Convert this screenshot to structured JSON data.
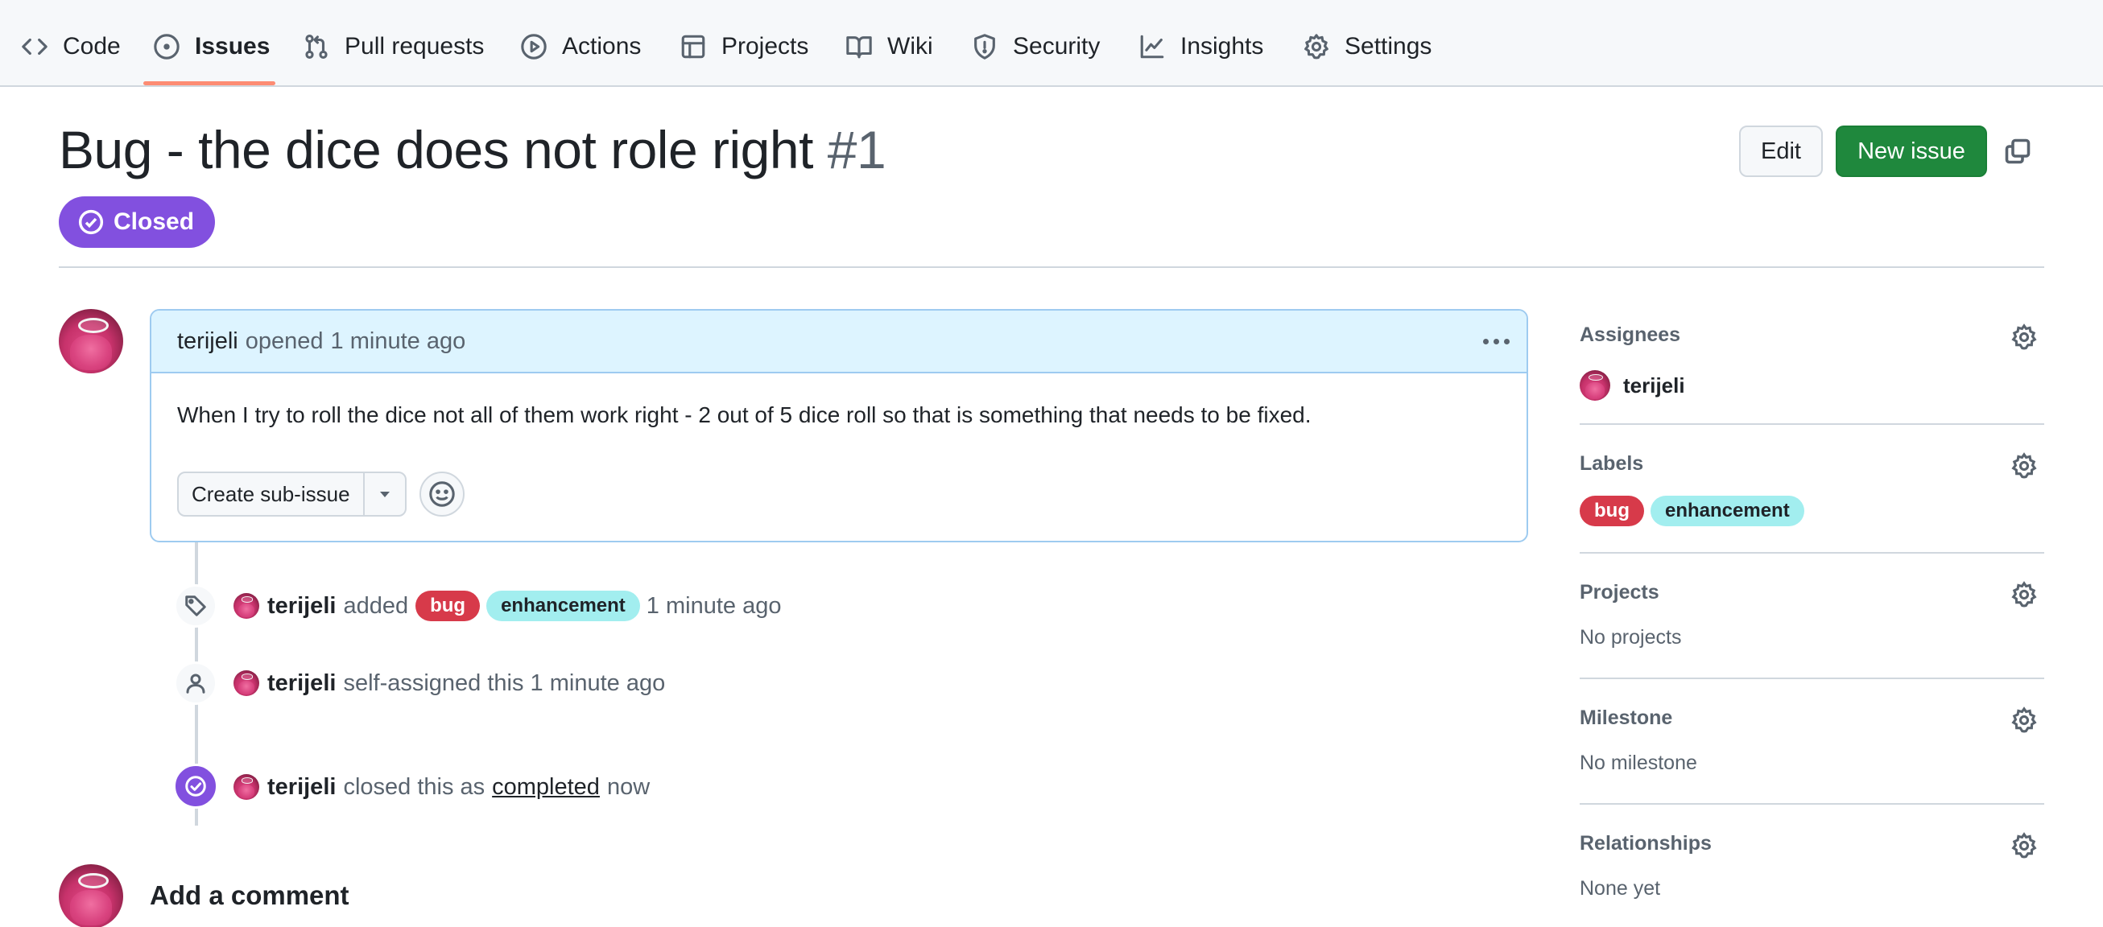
{
  "nav": {
    "items": [
      {
        "label": "Code",
        "icon": "code-icon"
      },
      {
        "label": "Issues",
        "icon": "issue-opened-icon",
        "active": true
      },
      {
        "label": "Pull requests",
        "icon": "git-pull-request-icon"
      },
      {
        "label": "Actions",
        "icon": "play-icon"
      },
      {
        "label": "Projects",
        "icon": "table-icon"
      },
      {
        "label": "Wiki",
        "icon": "book-icon"
      },
      {
        "label": "Security",
        "icon": "shield-icon"
      },
      {
        "label": "Insights",
        "icon": "graph-icon"
      },
      {
        "label": "Settings",
        "icon": "gear-icon"
      }
    ]
  },
  "issue": {
    "title": "Bug - the dice does not role right",
    "number": "#1",
    "state": "Closed",
    "edit_label": "Edit",
    "new_issue_label": "New issue"
  },
  "comment": {
    "author": "terijeli",
    "action": "opened",
    "time": "1 minute ago",
    "body": "When I try to roll the dice not all of them work right - 2 out of 5 dice roll so that is something that needs to be fixed.",
    "create_subissue_label": "Create sub-issue"
  },
  "timeline": {
    "labeled": {
      "user": "terijeli",
      "verb": "added",
      "labels": [
        "bug",
        "enhancement"
      ],
      "time": "1 minute ago"
    },
    "assigned": {
      "user": "terijeli",
      "text": "self-assigned this 1 minute ago"
    },
    "closed": {
      "user": "terijeli",
      "text_before": "closed this as",
      "link": "completed",
      "time": "now"
    }
  },
  "add_comment": {
    "heading": "Add a comment"
  },
  "sidebar": {
    "assignees": {
      "heading": "Assignees",
      "user": "terijeli"
    },
    "labels": {
      "heading": "Labels",
      "items": [
        "bug",
        "enhancement"
      ]
    },
    "projects": {
      "heading": "Projects",
      "value": "No projects"
    },
    "milestone": {
      "heading": "Milestone",
      "value": "No milestone"
    },
    "relationships": {
      "heading": "Relationships",
      "value": "None yet"
    }
  },
  "colors": {
    "closed_purple": "#8250df",
    "new_issue_green": "#1f883d",
    "bug_label": "#d73a4a",
    "enhancement_label": "#a2eeef",
    "nav_underline": "#fd8c73"
  }
}
